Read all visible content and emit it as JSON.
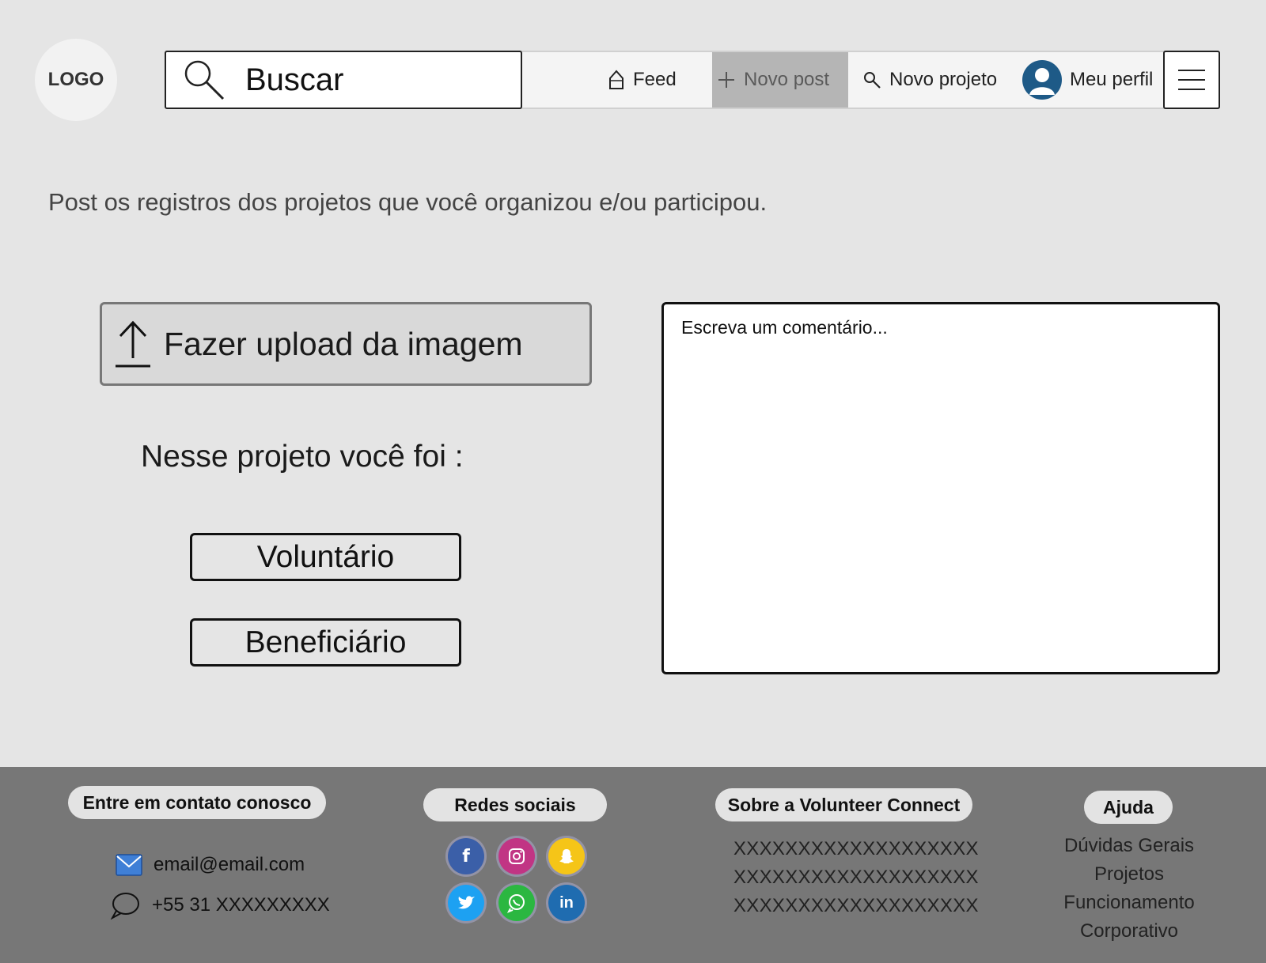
{
  "header": {
    "logo_text": "LOGO",
    "search_placeholder": "Buscar",
    "nav": {
      "feed": "Feed",
      "novo_post": "Novo post",
      "novo_projeto": "Novo projeto",
      "meu_perfil": "Meu perfil"
    }
  },
  "main": {
    "intro_text": "Post os registros dos projetos que você organizou e/ou participou.",
    "upload_label": "Fazer upload da imagem",
    "role_question": "Nesse projeto você foi :",
    "roles": {
      "voluntario": "Voluntário",
      "beneficiario": "Beneficiário"
    },
    "comment_placeholder": "Escreva um comentário..."
  },
  "footer": {
    "contato": {
      "title": "Entre em contato conosco",
      "email": "email@email.com",
      "phone": "+55 31 XXXXXXXXX"
    },
    "redes": {
      "title": "Redes sociais",
      "icons": [
        "facebook-icon",
        "instagram-icon",
        "snapchat-icon",
        "twitter-icon",
        "whatsapp-icon",
        "linkedin-icon"
      ]
    },
    "sobre": {
      "title": "Sobre a Volunteer Connect",
      "lines": [
        "XXXXXXXXXXXXXXXXXXX",
        "XXXXXXXXXXXXXXXXXXX",
        "XXXXXXXXXXXXXXXXXXX"
      ]
    },
    "ajuda": {
      "title": "Ajuda",
      "links": [
        "Dúvidas Gerais",
        "Projetos",
        "Funcionamento",
        "Corporativo"
      ]
    }
  },
  "colors": {
    "background": "#e5e5e5",
    "footer": "#777777",
    "active_nav": "#b5b5b5",
    "avatar": "#1e5a87"
  }
}
